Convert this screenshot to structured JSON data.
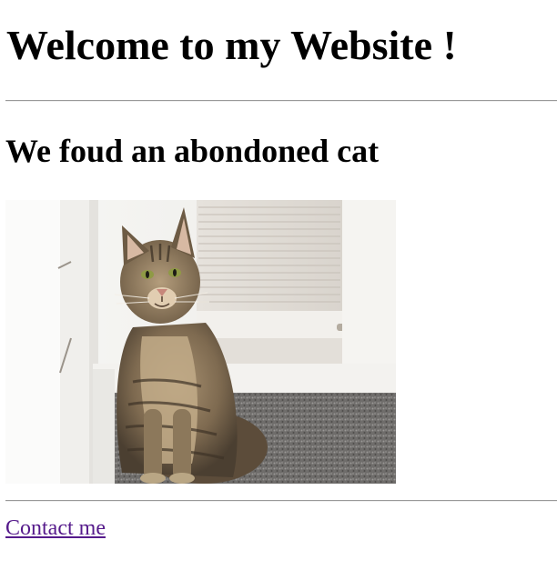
{
  "page": {
    "heading": "Welcome to my Website !",
    "subheading": "We foud an abondoned cat",
    "image": {
      "subject": "tabby-cat-photo"
    },
    "contact_link": "Contact me"
  },
  "colors": {
    "background": "#ffffff",
    "text": "#000000",
    "visited_link": "#551a8b",
    "rule": "#9a9a9a"
  }
}
